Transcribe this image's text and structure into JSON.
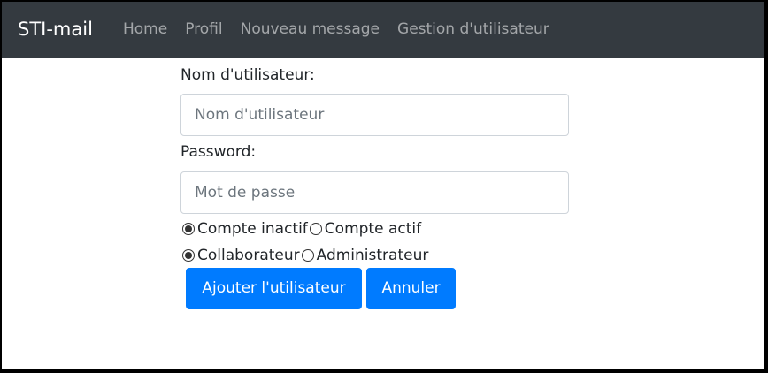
{
  "navbar": {
    "brand": "STI-mail",
    "links": [
      "Home",
      "Profil",
      "Nouveau message",
      "Gestion d'utilisateur"
    ]
  },
  "form": {
    "username": {
      "label": "Nom d'utilisateur:",
      "placeholder": "Nom d'utilisateur",
      "value": ""
    },
    "password": {
      "label": "Password:",
      "placeholder": "Mot de passe",
      "value": ""
    },
    "account_status": {
      "options": [
        "Compte inactif",
        "Compte actif"
      ],
      "selected": "Compte inactif"
    },
    "role": {
      "options": [
        "Collaborateur",
        "Administrateur"
      ],
      "selected": "Collaborateur"
    },
    "buttons": {
      "add": "Ajouter l'utilisateur",
      "cancel": "Annuler"
    }
  },
  "colors": {
    "navbar_bg": "#343a40",
    "primary": "#007bff",
    "nav_link": "rgba(255,255,255,0.55)"
  }
}
